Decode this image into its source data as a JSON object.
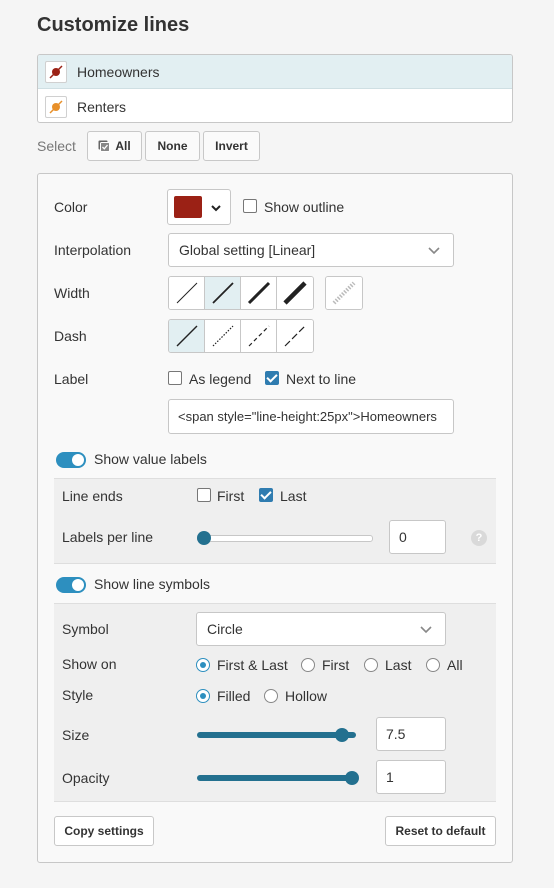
{
  "title": "Customize lines",
  "lines": [
    {
      "name": "Homeowners",
      "color": "#9b2115",
      "selected": true
    },
    {
      "name": "Renters",
      "color": "#e8902a",
      "selected": false
    }
  ],
  "select_bar": {
    "label": "Select",
    "all": "All",
    "none": "None",
    "invert": "Invert"
  },
  "color": {
    "label": "Color",
    "value": "#9b2115",
    "show_outline": "Show outline"
  },
  "interpolation": {
    "label": "Interpolation",
    "value": "Global setting [Linear]"
  },
  "width": {
    "label": "Width"
  },
  "dash": {
    "label": "Dash"
  },
  "label_section": {
    "label": "Label",
    "as_legend": "As legend",
    "next_to_line": "Next to line",
    "text_value": "<span style=\"line-height:25px\">Homeowners"
  },
  "value_labels": {
    "toggle": "Show value labels",
    "line_ends": "Line ends",
    "first": "First",
    "last": "Last",
    "labels_per_line": "Labels per line",
    "labels_per_line_value": "0",
    "labels_per_line_fraction": 0,
    "help": "?"
  },
  "symbols": {
    "toggle": "Show line symbols",
    "symbol_label": "Symbol",
    "symbol_value": "Circle",
    "show_on_label": "Show on",
    "show_on": [
      "First & Last",
      "First",
      "Last",
      "All"
    ],
    "style_label": "Style",
    "style": [
      "Filled",
      "Hollow"
    ],
    "size_label": "Size",
    "size_value": "7.5",
    "size_fraction": 0.95,
    "opacity_label": "Opacity",
    "opacity_value": "1",
    "opacity_fraction": 1
  },
  "footer": {
    "copy": "Copy settings",
    "reset": "Reset to default"
  },
  "colors": {
    "accent": "#2d8fbf",
    "slider": "#23708f",
    "selected_row": "#e2eff2"
  }
}
